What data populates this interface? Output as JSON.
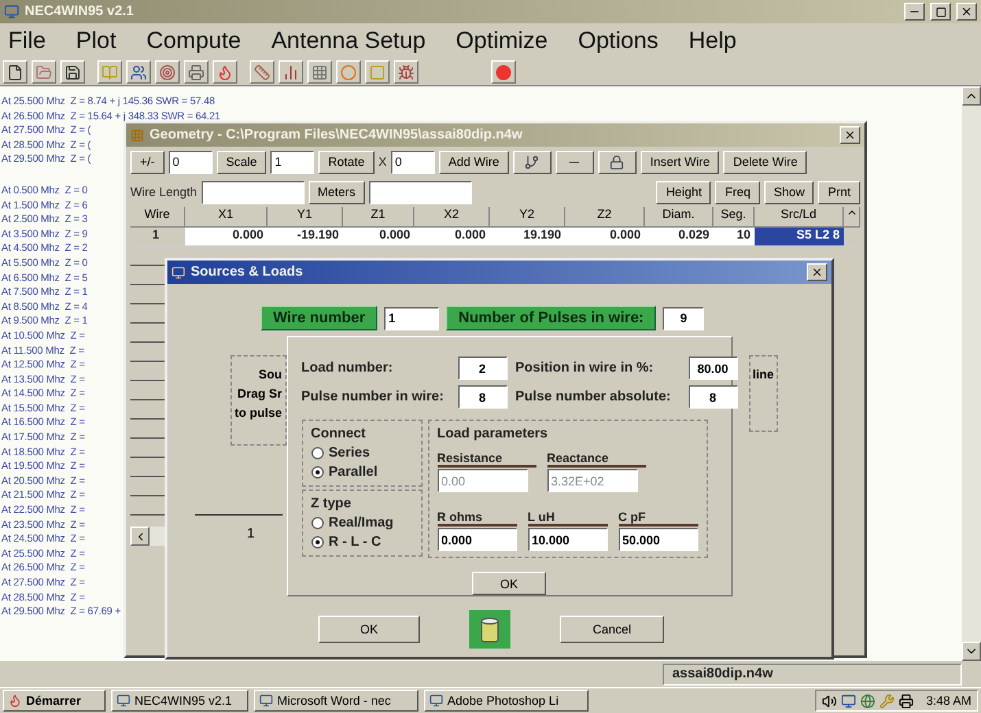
{
  "window": {
    "title": "NEC4WIN95 v2.1"
  },
  "menu": [
    "File",
    "Plot",
    "Compute",
    "Antenna Setup",
    "Optimize",
    "Options",
    "Help"
  ],
  "output_top": [
    "At 25.500 Mhz  Z = 8.74 + j 145.36 SWR = 57.48",
    "At 26.500 Mhz  Z = 15.64 + j 348.33 SWR = 64.21",
    "At 27.500 Mhz  Z = (",
    "At 28.500 Mhz  Z = (",
    "At 29.500 Mhz  Z = ("
  ],
  "output_lines": [
    "At 0.500 Mhz  Z = 0",
    "At 1.500 Mhz  Z = 6",
    "At 2.500 Mhz  Z = 3",
    "At 3.500 Mhz  Z = 9",
    "At 4.500 Mhz  Z = 2",
    "At 5.500 Mhz  Z = 0",
    "At 6.500 Mhz  Z = 5",
    "At 7.500 Mhz  Z = 1",
    "At 8.500 Mhz  Z = 4",
    "At 9.500 Mhz  Z = 1",
    "At 10.500 Mhz  Z =",
    "At 11.500 Mhz  Z =",
    "At 12.500 Mhz  Z =",
    "At 13.500 Mhz  Z =",
    "At 14.500 Mhz  Z =",
    "At 15.500 Mhz  Z =",
    "At 16.500 Mhz  Z =",
    "At 17.500 Mhz  Z =",
    "At 18.500 Mhz  Z =",
    "At 19.500 Mhz  Z =",
    "At 20.500 Mhz  Z =",
    "At 21.500 Mhz  Z =",
    "At 22.500 Mhz  Z =",
    "At 23.500 Mhz  Z =",
    "At 24.500 Mhz  Z =",
    "At 25.500 Mhz  Z =",
    "At 26.500 Mhz  Z =",
    "At 27.500 Mhz  Z =",
    "At 28.500 Mhz  Z =",
    "At 29.500 Mhz  Z = 67.69 +"
  ],
  "geometry": {
    "title": "Geometry - C:\\Program Files\\NEC4WIN95\\assai80dip.n4w",
    "toolbar": [
      {
        "kind": "button",
        "label": "+/-"
      },
      {
        "kind": "field",
        "value": "0"
      },
      {
        "kind": "button",
        "label": "Scale"
      },
      {
        "kind": "field",
        "value": "1"
      },
      {
        "kind": "button",
        "label": "Rotate"
      },
      {
        "kind": "label",
        "label": "X"
      },
      {
        "kind": "field",
        "value": "0"
      },
      {
        "kind": "button",
        "label": "Add Wire"
      },
      {
        "kind": "icon"
      },
      {
        "kind": "icon"
      },
      {
        "kind": "icon"
      },
      {
        "kind": "button",
        "label": "Insert Wire"
      },
      {
        "kind": "button",
        "label": "Delete Wire"
      }
    ],
    "toolbar2": [
      {
        "kind": "label",
        "label": "Wire Length"
      },
      {
        "kind": "field"
      },
      {
        "kind": "button",
        "label": "Meters"
      },
      {
        "kind": "field"
      },
      {
        "kind": "spacer"
      },
      {
        "kind": "button",
        "label": "Height"
      },
      {
        "kind": "button",
        "label": "Freq"
      },
      {
        "kind": "button",
        "label": "Show"
      },
      {
        "kind": "button",
        "label": "Prnt"
      }
    ],
    "columns": [
      "Wire",
      "X1",
      "Y1",
      "Z1",
      "X2",
      "Y2",
      "Z2",
      "Diam.",
      "Seg.",
      "Src/Ld"
    ],
    "rows": [
      {
        "cells": [
          {
            "text": "1",
            "selected": false
          },
          {
            "text": "0.000",
            "selected": false
          },
          {
            "text": "-19.190",
            "selected": false
          },
          {
            "text": "0.000",
            "selected": false
          },
          {
            "text": "0.000",
            "selected": false
          },
          {
            "text": "19.190",
            "selected": false
          },
          {
            "text": "0.000",
            "selected": false
          },
          {
            "text": "0.029",
            "selected": false
          },
          {
            "text": "10",
            "selected": false
          },
          {
            "text": "S5 L2 8",
            "selected": true
          }
        ]
      }
    ]
  },
  "sources_loads": {
    "title": "Sources & Loads",
    "wire_number": {
      "label": "Wire number",
      "value": "1"
    },
    "pulses": {
      "label": "Number of Pulses in wire:",
      "value": "9"
    },
    "hidden_panel": [
      "Sou",
      "Drag Sr",
      "to pulse"
    ],
    "hidden_panel_right": "line",
    "left_number": "1",
    "load_fields": [
      {
        "label": "Load number:",
        "value": "2"
      },
      {
        "label": "Position in wire in %:",
        "value": "80.00"
      },
      {
        "label": "Pulse number in wire:",
        "value": "8"
      },
      {
        "label": "Pulse number absolute:",
        "value": "8"
      }
    ],
    "connect": {
      "title": "Connect",
      "options": [
        {
          "label": "Series",
          "selected": false
        },
        {
          "label": "Parallel",
          "selected": true
        }
      ]
    },
    "z_type": {
      "title": "Z type",
      "options": [
        {
          "label": "Real/Imag",
          "selected": false
        },
        {
          "label": "R - L - C",
          "selected": true
        }
      ]
    },
    "load_parameters": {
      "title": "Load parameters",
      "results": [
        {
          "label": "Resistance",
          "value": "0.00"
        },
        {
          "label": "Reactance",
          "value": "3.32E+02"
        }
      ],
      "inputs": [
        {
          "label": "R ohms",
          "value": "0.000"
        },
        {
          "label": "L uH",
          "value": "10.000"
        },
        {
          "label": "C pF",
          "value": "50.000"
        }
      ]
    },
    "inner_ok": "OK",
    "ok": "OK",
    "cancel": "Cancel"
  },
  "status_bar": "assai80dip.n4w",
  "taskbar": {
    "start": "Démarrer",
    "tasks": [
      "NEC4WIN95 v2.1",
      "Microsoft Word - nec",
      "Adobe Photoshop Li"
    ],
    "clock": "3:48 AM"
  }
}
